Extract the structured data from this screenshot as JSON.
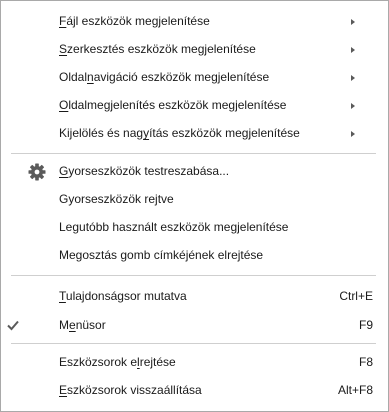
{
  "menu": {
    "toolbars_submenus": [
      {
        "pre": "",
        "key": "F",
        "post": "ájl eszközök megjelenítése",
        "arrow_icon": "chevron-right-icon"
      },
      {
        "pre": "",
        "key": "S",
        "post": "zerkesztés eszközök megjelenítése",
        "arrow_icon": "chevron-right-icon"
      },
      {
        "pre": "Oldal",
        "key": "n",
        "post": "avigáció eszközök megjelenítése",
        "arrow_icon": "chevron-right-icon"
      },
      {
        "pre": "",
        "key": "O",
        "post": "ldalmegjelenítés eszközök megjelenítése",
        "arrow_icon": "chevron-right-icon"
      },
      {
        "pre": "Kijelölés és nag",
        "key": "y",
        "post": "ítás eszközök megjelenítése",
        "arrow_icon": "chevron-right-icon"
      }
    ],
    "quick_tools": {
      "customize": {
        "pre": "",
        "key": "G",
        "post": "yorseszközök testreszabása...",
        "icon": "gear-icon"
      },
      "hidden_label": "Gyorseszközök rejtve",
      "recent_label": "Legutóbb használt eszközök megjelenítése",
      "share_label": "Megosztás gomb címkéjének elrejtése"
    },
    "bars": {
      "properties": {
        "pre": "",
        "key": "T",
        "post": "ulajdonságsor mutatva",
        "shortcut": "Ctrl+E"
      },
      "menubar": {
        "pre": "M",
        "key": "e",
        "post": "nüsor",
        "shortcut": "F9",
        "checked": true,
        "check_icon": "checkmark-icon"
      }
    },
    "toolbars": {
      "hide": {
        "pre": "Eszközsorok e",
        "key": "l",
        "post": "rejtése",
        "shortcut": "F8"
      },
      "reset": {
        "pre": "",
        "key": "E",
        "post": "szközsorok visszaállítása",
        "shortcut": "Alt+F8"
      }
    },
    "colors": {
      "text": "#1a1a1a",
      "separator": "#cfcfcf",
      "icon": "#5a5a5a",
      "border": "#a9a9a9"
    }
  }
}
